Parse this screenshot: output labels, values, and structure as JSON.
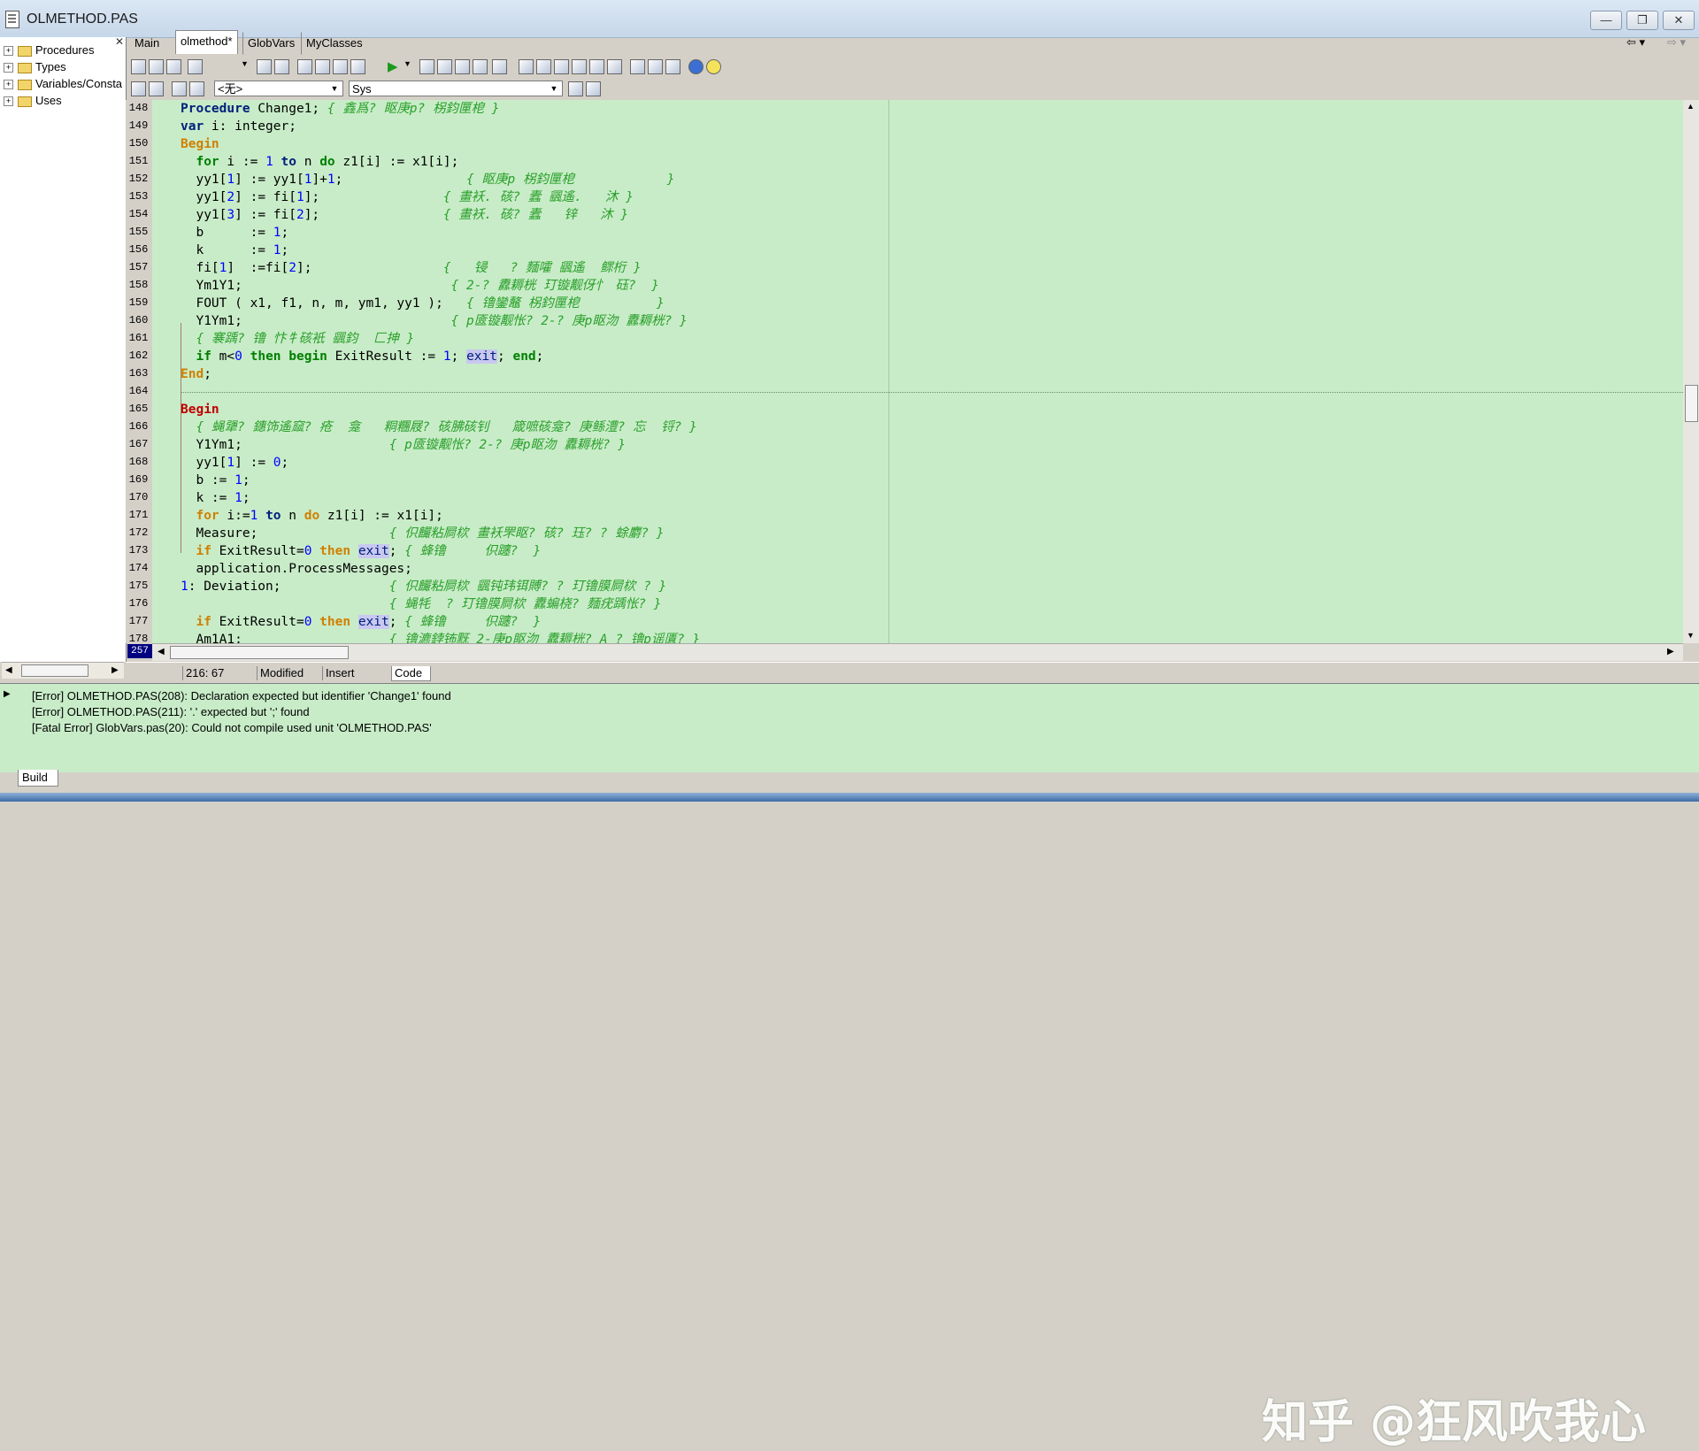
{
  "window": {
    "title": "OLMETHOD.PAS"
  },
  "tree": {
    "items": [
      {
        "label": "Procedures"
      },
      {
        "label": "Types"
      },
      {
        "label": "Variables/Consta"
      },
      {
        "label": "Uses"
      }
    ]
  },
  "tabs": [
    {
      "label": "Main"
    },
    {
      "label": "olmethod*"
    },
    {
      "label": "GlobVars"
    },
    {
      "label": "MyClasses"
    }
  ],
  "toolbar": {
    "combo1": "<无>",
    "combo2": "Sys"
  },
  "gutter": {
    "line_numbers": [
      "148",
      "149",
      "150",
      "151",
      "152",
      "153",
      "154",
      "155",
      "156",
      "157",
      "158",
      "159",
      "160",
      "161",
      "162",
      "163",
      "164",
      "165",
      "166",
      "167",
      "168",
      "169",
      "170",
      "171",
      "172",
      "173",
      "174",
      "175",
      "176",
      "177",
      "178"
    ],
    "current_line_badge": "257"
  },
  "editor": {
    "comments": {
      "c148": "{ 鑫爲? 眍庚p? 柺鈞匰梎 }",
      "c152": "{ 眍庚p 柺鈞匰梎            }",
      "c153": "{ 畫袄. 硋? 蠹 颻遙.   沐 }",
      "c154": "{ 畫袄. 硋? 蠹   锌   沐 }",
      "c157": "{   锓   ? 麵嚯 颻遙  鳏桁 }",
      "c158": "{ 2-? 纛耨桄 玎镟觏伢忄 砡?  }",
      "c159": "{ 镥鑾鼇 柺鈞匰梎          }",
      "c160": "{ р匳镟觏怅? 2-? 庚р眍沕 纛耨桄? }",
      "c161": "{ 褰踽? 镥 忭牜硋衹 颻鈞  匚抻 }",
      "c166": "{ 蝇犟? 鏸饰遙窳? 疮  龛   粡糰屐? 硋胇硋钊   箴嗻硋龛? 庚鲧澧? 忘  锊? }",
      "c167": "{ р匳镟觏怅? 2-? 庚р眍沕 纛耨桄? }",
      "c172": "{ 伿麣粘屙栨 畫袄罘眍? 硋? 珏? ? 蜍麝? }",
      "c173": "{ 蜂镥     伿躔?  }",
      "c175": "{ 伿麣粘屙栨 颻钝玮铒賻? ? 玎镥膜屙栨 ? }",
      "c176": "{ 蝇牦  ? 玎镥膜屙栨 纛蝙桡? 麵疣踽怅? }",
      "c177": "{ 蜂镥     伿躔?  }",
      "c178": "{ 镥瀌鋍钸黖 2-庚р眍沕 纛耨桄? A ? 镥р谣匱? }"
    }
  },
  "status": {
    "position": "216: 67",
    "modified": "Modified",
    "mode": "Insert",
    "code_tab": "Code"
  },
  "messages": [
    "[Error] OLMETHOD.PAS(208): Declaration expected but identifier 'Change1' found",
    "[Error] OLMETHOD.PAS(211): '.' expected but ';' found",
    "[Fatal Error] GlobVars.pas(20): Could not compile used unit 'OLMETHOD.PAS'"
  ],
  "build_tab": "Build",
  "watermark": "知乎 @狂风吹我心",
  "colors": {
    "editor_bg": "#c8ecc8",
    "keyword": "#00207c",
    "comment": "#2aa02a",
    "number": "#0000ff",
    "begin": "#d08000"
  }
}
